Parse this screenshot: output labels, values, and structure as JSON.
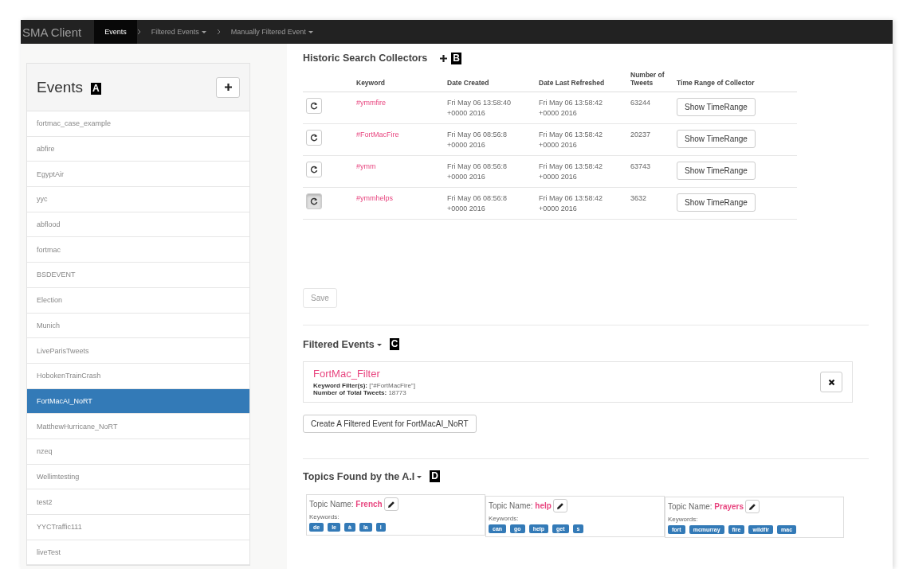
{
  "navbar": {
    "brand": "SMA Client",
    "items": [
      {
        "label": "Events",
        "selected": true,
        "dropdown": false
      },
      {
        "label": "Filtered Events",
        "selected": false,
        "dropdown": true
      },
      {
        "label": "Manually Filtered Event",
        "selected": false,
        "dropdown": true
      }
    ]
  },
  "sidebar": {
    "title": "Events",
    "marker": "A",
    "items": [
      {
        "label": "fortmac_case_example",
        "selected": false
      },
      {
        "label": "abfire",
        "selected": false
      },
      {
        "label": "EgyptAir",
        "selected": false
      },
      {
        "label": "yyc",
        "selected": false
      },
      {
        "label": "abflood",
        "selected": false
      },
      {
        "label": "fortmac",
        "selected": false
      },
      {
        "label": "BSDEVENT",
        "selected": false
      },
      {
        "label": "Election",
        "selected": false
      },
      {
        "label": "Munich",
        "selected": false
      },
      {
        "label": "LiveParisTweets",
        "selected": false
      },
      {
        "label": "HobokenTrainCrash",
        "selected": false
      },
      {
        "label": "FortMacAI_NoRT",
        "selected": true
      },
      {
        "label": "MatthewHurricane_NoRT",
        "selected": false
      },
      {
        "label": "nzeq",
        "selected": false
      },
      {
        "label": "Wellimtesting",
        "selected": false
      },
      {
        "label": "test2",
        "selected": false
      },
      {
        "label": "YYCTraffic111",
        "selected": false
      },
      {
        "label": "liveTest",
        "selected": false
      }
    ]
  },
  "collectors": {
    "title": "Historic Search Collectors",
    "marker": "B",
    "columns": [
      "Keyword",
      "Date Created",
      "Date Last Refreshed",
      "Number of Tweets",
      "Time Range of Collector"
    ],
    "rows": [
      {
        "keyword": "#ymmfire",
        "created": "Fri May 06 13:58:40 +0000 2016",
        "refreshed": "Fri May 06 13:58:42 +0000 2016",
        "tweets": "63244",
        "action": "Show TimeRange",
        "pressed": false
      },
      {
        "keyword": "#FortMacFire",
        "created": "Fri May 06 08:56:8 +0000 2016",
        "refreshed": "Fri May 06 13:58:42 +0000 2016",
        "tweets": "20237",
        "action": "Show TimeRange",
        "pressed": false
      },
      {
        "keyword": "#ymm",
        "created": "Fri May 06 08:56:8 +0000 2016",
        "refreshed": "Fri May 06 13:58:42 +0000 2016",
        "tweets": "63743",
        "action": "Show TimeRange",
        "pressed": false
      },
      {
        "keyword": "#ymmhelps",
        "created": "Fri May 06 08:56:8 +0000 2016",
        "refreshed": "Fri May 06 13:58:42 +0000 2016",
        "tweets": "3632",
        "action": "Show TimeRange",
        "pressed": true
      }
    ],
    "save": "Save"
  },
  "filtered_events": {
    "title": "Filtered Events",
    "marker": "C",
    "items": [
      {
        "name": "FortMac_Filter",
        "filter_label": "Keyword Filter(s):",
        "filter_value": "[\"#FortMacFire\"]",
        "total_label": "Number of Total Tweets:",
        "total_value": "18773"
      }
    ],
    "create_button": "Create A Filtered Event for FortMacAI_NoRT"
  },
  "topics": {
    "title": "Topics Found by the A.I",
    "marker": "D",
    "items": [
      {
        "name_label": "Topic Name:",
        "name": "French",
        "keywords_label": "Keywords:",
        "keywords": [
          "de",
          "le",
          "à",
          "la",
          "l"
        ]
      },
      {
        "name_label": "Topic Name:",
        "name": "help",
        "keywords_label": "Keywords:",
        "keywords": [
          "can",
          "go",
          "help",
          "get",
          "s"
        ]
      },
      {
        "name_label": "Topic Name:",
        "name": "Prayers",
        "keywords_label": "Keywords:",
        "keywords": [
          "fort",
          "mcmurray",
          "fire",
          "wildfir",
          "mac"
        ]
      }
    ]
  }
}
